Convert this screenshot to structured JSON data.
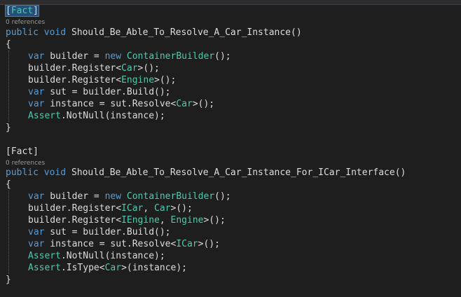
{
  "editor": {
    "accent_colors": {
      "keyword": "#569cd6",
      "type": "#4ec9b0",
      "text": "#dcdcdc",
      "codelens": "#999999",
      "highlight": "#264f78"
    },
    "method1": {
      "attr_open": "[",
      "attr_name": "Fact",
      "attr_close": "]",
      "references": "0 references",
      "signature": {
        "kw1": "public",
        "kw2": "void",
        "name": "Should_Be_Able_To_Resolve_A_Car_Instance",
        "parens": "()"
      },
      "open_brace": "{",
      "close_brace": "}",
      "lines": [
        [
          {
            "t": "var",
            "c": "kw"
          },
          {
            "t": " builder = ",
            "c": "pl"
          },
          {
            "t": "new",
            "c": "kw"
          },
          {
            "t": " ",
            "c": "pl"
          },
          {
            "t": "ContainerBuilder",
            "c": "ty"
          },
          {
            "t": "();",
            "c": "pl"
          }
        ],
        [
          {
            "t": "builder.Register<",
            "c": "pl"
          },
          {
            "t": "Car",
            "c": "ty"
          },
          {
            "t": ">();",
            "c": "pl"
          }
        ],
        [
          {
            "t": "builder.Register<",
            "c": "pl"
          },
          {
            "t": "Engine",
            "c": "ty"
          },
          {
            "t": ">();",
            "c": "pl"
          }
        ],
        [
          {
            "t": "var",
            "c": "kw"
          },
          {
            "t": " sut = builder.Build();",
            "c": "pl"
          }
        ],
        [
          {
            "t": "var",
            "c": "kw"
          },
          {
            "t": " instance = sut.Resolve<",
            "c": "pl"
          },
          {
            "t": "Car",
            "c": "ty"
          },
          {
            "t": ">();",
            "c": "pl"
          }
        ],
        [
          {
            "t": "Assert",
            "c": "ty"
          },
          {
            "t": ".NotNull(instance);",
            "c": "pl"
          }
        ]
      ]
    },
    "method2": {
      "attribute": "[Fact]",
      "references": "0 references",
      "signature": {
        "kw1": "public",
        "kw2": "void",
        "name": "Should_Be_Able_To_Resolve_A_Car_Instance_For_ICar_Interface",
        "parens": "()"
      },
      "open_brace": "{",
      "close_brace": "}",
      "lines": [
        [
          {
            "t": "var",
            "c": "kw"
          },
          {
            "t": " builder = ",
            "c": "pl"
          },
          {
            "t": "new",
            "c": "kw"
          },
          {
            "t": " ",
            "c": "pl"
          },
          {
            "t": "ContainerBuilder",
            "c": "ty"
          },
          {
            "t": "();",
            "c": "pl"
          }
        ],
        [
          {
            "t": "builder.Register<",
            "c": "pl"
          },
          {
            "t": "ICar",
            "c": "ty"
          },
          {
            "t": ", ",
            "c": "pl"
          },
          {
            "t": "Car",
            "c": "ty"
          },
          {
            "t": ">();",
            "c": "pl"
          }
        ],
        [
          {
            "t": "builder.Register<",
            "c": "pl"
          },
          {
            "t": "IEngine",
            "c": "ty"
          },
          {
            "t": ", ",
            "c": "pl"
          },
          {
            "t": "Engine",
            "c": "ty"
          },
          {
            "t": ">();",
            "c": "pl"
          }
        ],
        [
          {
            "t": "var",
            "c": "kw"
          },
          {
            "t": " sut = builder.Build();",
            "c": "pl"
          }
        ],
        [
          {
            "t": "var",
            "c": "kw"
          },
          {
            "t": " instance = sut.Resolve<",
            "c": "pl"
          },
          {
            "t": "ICar",
            "c": "ty"
          },
          {
            "t": ">();",
            "c": "pl"
          }
        ],
        [
          {
            "t": "Assert",
            "c": "ty"
          },
          {
            "t": ".NotNull(instance);",
            "c": "pl"
          }
        ],
        [
          {
            "t": "Assert",
            "c": "ty"
          },
          {
            "t": ".IsType<",
            "c": "pl"
          },
          {
            "t": "Car",
            "c": "ty"
          },
          {
            "t": ">(instance);",
            "c": "pl"
          }
        ]
      ]
    }
  }
}
